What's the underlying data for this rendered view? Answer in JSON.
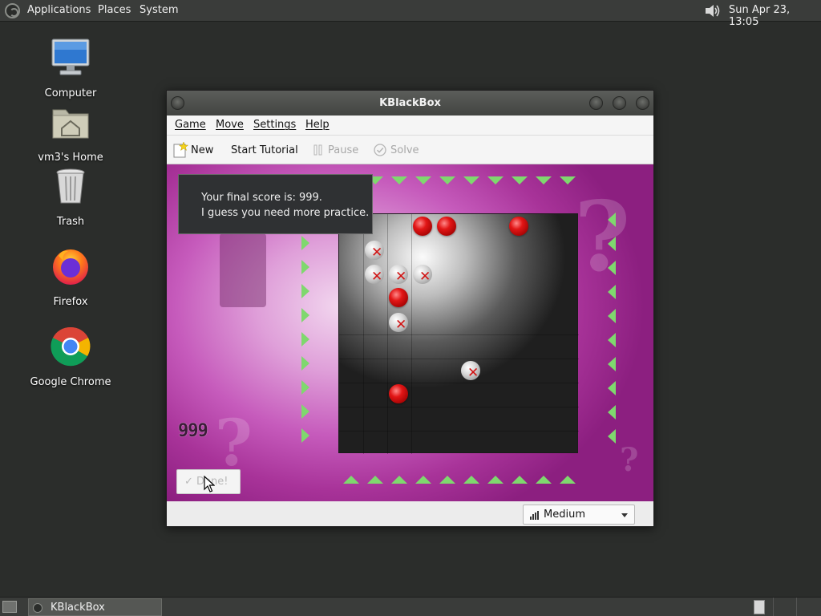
{
  "top_panel": {
    "menus": [
      "Applications",
      "Places",
      "System"
    ],
    "clock": "Sun Apr 23, 13:05",
    "icons": [
      "distro-logo-icon",
      "volume-icon"
    ]
  },
  "desktop": {
    "icons": [
      {
        "label": "Computer",
        "icon": "computer-icon"
      },
      {
        "label": "vm3's Home",
        "icon": "home-folder-icon"
      },
      {
        "label": "Trash",
        "icon": "trash-icon"
      },
      {
        "label": "Firefox",
        "icon": "firefox-icon"
      },
      {
        "label": "Google Chrome",
        "icon": "chrome-icon"
      }
    ]
  },
  "window": {
    "title": "KBlackBox",
    "menubar": [
      "Game",
      "Move",
      "Settings",
      "Help"
    ],
    "toolbar": {
      "new_label": "New",
      "tutorial_label": "Start Tutorial",
      "pause_label": "Pause",
      "solve_label": "Solve"
    },
    "game": {
      "popup_line1": "Your final score is: 999.",
      "popup_line2": "I guess you need more practice.",
      "score_display": "999",
      "done_label": "Done!",
      "board_size": 10,
      "red_balls": [
        [
          3,
          0
        ],
        [
          4,
          0
        ],
        [
          7,
          0
        ],
        [
          2,
          3
        ],
        [
          2,
          7
        ]
      ],
      "wrong_balls": [
        [
          1,
          1
        ],
        [
          1,
          2
        ],
        [
          2,
          2
        ],
        [
          3,
          2
        ],
        [
          2,
          4
        ],
        [
          5,
          6
        ]
      ]
    },
    "statusbar": {
      "difficulty": "Medium"
    }
  },
  "colors": {
    "arrow": "#7fd86e",
    "ball_red": "#e21616",
    "wrong_mark": "#d11313",
    "game_bg": "#c65bbc"
  },
  "taskbar": {
    "item_label": "KBlackBox"
  }
}
